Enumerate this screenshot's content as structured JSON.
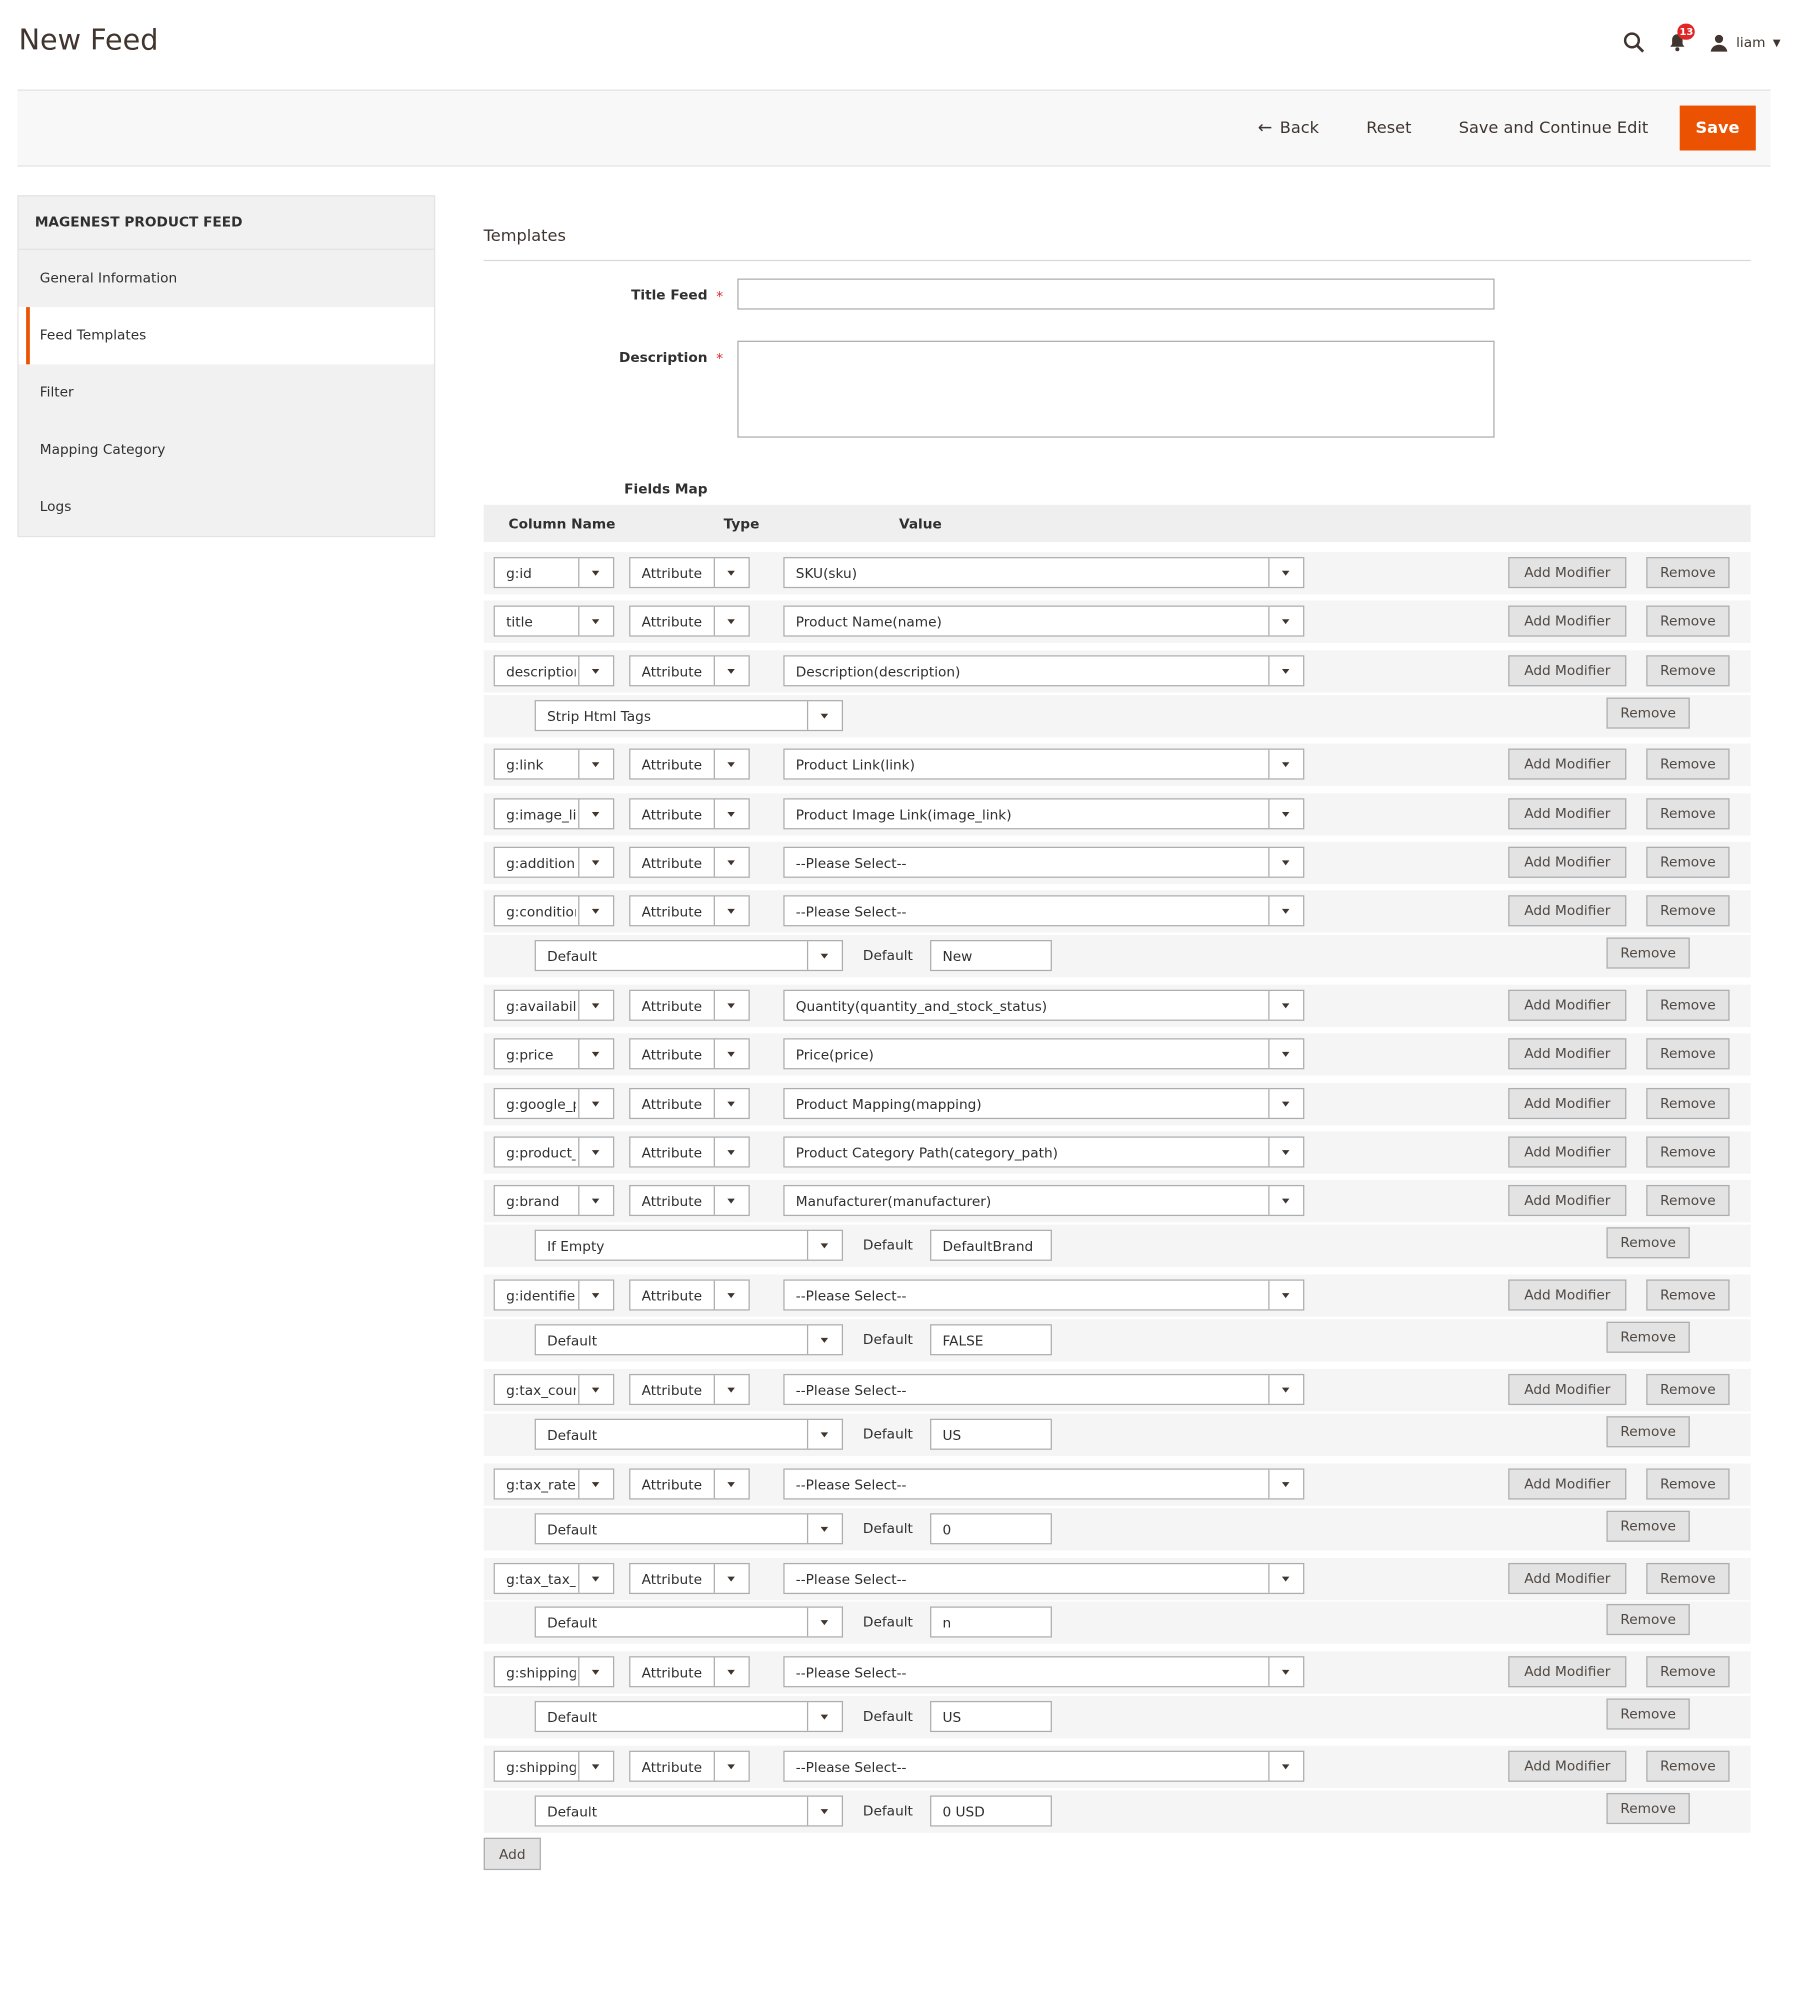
{
  "page": {
    "title": "New Feed"
  },
  "header": {
    "notification_count": "13",
    "user_name": "liam"
  },
  "actions": {
    "back": "Back",
    "reset": "Reset",
    "save_continue": "Save and Continue Edit",
    "save": "Save"
  },
  "sidebar": {
    "title": "MAGENEST PRODUCT FEED",
    "items": [
      {
        "label": "General Information",
        "active": false
      },
      {
        "label": "Feed Templates",
        "active": true
      },
      {
        "label": "Filter",
        "active": false
      },
      {
        "label": "Mapping Category",
        "active": false
      },
      {
        "label": "Logs",
        "active": false
      }
    ]
  },
  "form": {
    "section_title": "Templates",
    "title_feed_label": "Title Feed",
    "description_label": "Description",
    "required_mark": "*",
    "title_feed_value": "",
    "description_value": "",
    "fields_map_label": "Fields Map",
    "columns": {
      "name": "Column Name",
      "type": "Type",
      "value": "Value"
    },
    "add_modifier_label": "Add Modifier",
    "remove_label": "Remove",
    "default_label": "Default",
    "add_button": "Add"
  },
  "fields": [
    {
      "column": "g:id",
      "type": "Attribute",
      "value": "SKU(sku)",
      "modifier": null
    },
    {
      "column": "title",
      "type": "Attribute",
      "value": "Product Name(name)",
      "modifier": null
    },
    {
      "column": "description",
      "type": "Attribute",
      "value": "Description(description)",
      "modifier": {
        "type": "Strip Html Tags",
        "default": null
      }
    },
    {
      "column": "g:link",
      "type": "Attribute",
      "value": "Product Link(link)",
      "modifier": null
    },
    {
      "column": "g:image_link",
      "type": "Attribute",
      "value": "Product Image Link(image_link)",
      "modifier": null
    },
    {
      "column": "g:additional_image_link",
      "type": "Attribute",
      "value": "--Please Select--",
      "modifier": null
    },
    {
      "column": "g:condition",
      "type": "Attribute",
      "value": "--Please Select--",
      "modifier": {
        "type": "Default",
        "default": "New"
      }
    },
    {
      "column": "g:availability",
      "type": "Attribute",
      "value": "Quantity(quantity_and_stock_status)",
      "modifier": null
    },
    {
      "column": "g:price",
      "type": "Attribute",
      "value": "Price(price)",
      "modifier": null
    },
    {
      "column": "g:google_product_category",
      "type": "Attribute",
      "value": "Product Mapping(mapping)",
      "modifier": null
    },
    {
      "column": "g:product_type",
      "type": "Attribute",
      "value": "Product Category Path(category_path)",
      "modifier": null
    },
    {
      "column": "g:brand",
      "type": "Attribute",
      "value": "Manufacturer(manufacturer)",
      "modifier": {
        "type": "If Empty",
        "default": "DefaultBrand"
      }
    },
    {
      "column": "g:identifier_exists",
      "type": "Attribute",
      "value": "--Please Select--",
      "modifier": {
        "type": "Default",
        "default": "FALSE"
      }
    },
    {
      "column": "g:tax_country",
      "type": "Attribute",
      "value": "--Please Select--",
      "modifier": {
        "type": "Default",
        "default": "US"
      }
    },
    {
      "column": "g:tax_rate",
      "type": "Attribute",
      "value": "--Please Select--",
      "modifier": {
        "type": "Default",
        "default": "0"
      }
    },
    {
      "column": "g:tax_tax_ship",
      "type": "Attribute",
      "value": "--Please Select--",
      "modifier": {
        "type": "Default",
        "default": "n"
      }
    },
    {
      "column": "g:shipping_country",
      "type": "Attribute",
      "value": "--Please Select--",
      "modifier": {
        "type": "Default",
        "default": "US"
      }
    },
    {
      "column": "g:shipping_price",
      "type": "Attribute",
      "value": "--Please Select--",
      "modifier": {
        "type": "Default",
        "default": "0 USD"
      }
    }
  ]
}
